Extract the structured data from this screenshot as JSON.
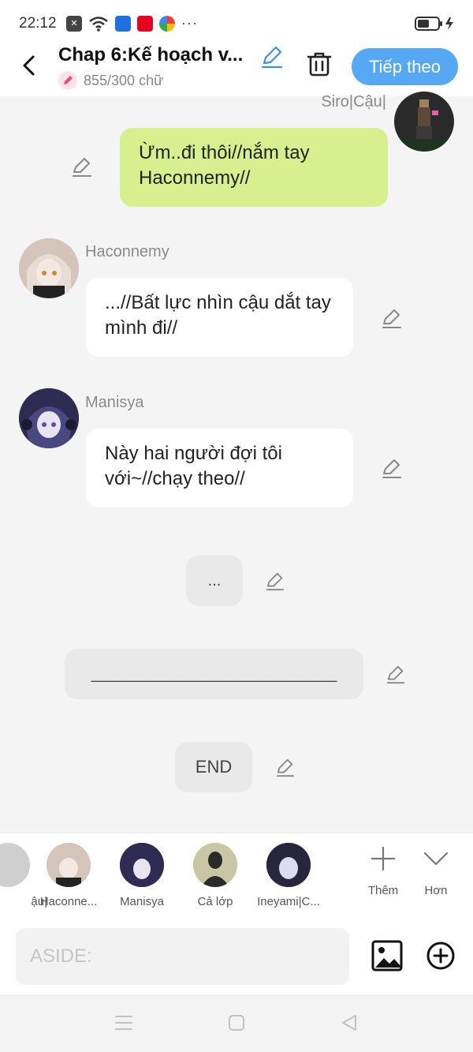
{
  "status": {
    "time": "22:12",
    "more": "···"
  },
  "header": {
    "title": "Chap 6:Kế hoạch v...",
    "word_count": "855/300 chữ",
    "next_label": "Tiếp theo"
  },
  "messages": [
    {
      "speaker": "Siro|Cậu|",
      "text": "Ừm..đi thôi//nắm tay Haconnemy//"
    },
    {
      "speaker": "Haconnemy",
      "text": "...//Bất lực nhìn cậu dắt tay mình đi//"
    },
    {
      "speaker": "Manisya",
      "text": "Này hai người đợi tôi với~//chạy theo//"
    }
  ],
  "narration": [
    {
      "text": "..."
    },
    {
      "text": "____________________________"
    },
    {
      "text": "END"
    }
  ],
  "cast": [
    {
      "label": "ậu|"
    },
    {
      "label": "Haconne..."
    },
    {
      "label": "Manisya"
    },
    {
      "label": "Cả lớp"
    },
    {
      "label": "Ineyami|C..."
    }
  ],
  "tools": {
    "add_label": "Thêm",
    "more_label": "Hơn"
  },
  "input": {
    "placeholder": "ASIDE:"
  },
  "colors": {
    "accent": "#56a8f5",
    "own_bubble": "#d6f08f",
    "bubble": "#ffffff",
    "narration_bubble": "#e9e9e9"
  }
}
